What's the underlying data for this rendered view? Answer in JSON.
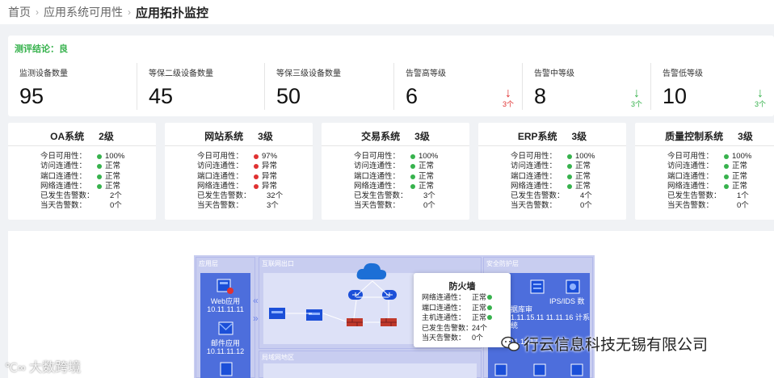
{
  "breadcrumb": {
    "items": [
      "首页",
      "应用系统可用性"
    ],
    "current": "应用拓扑监控"
  },
  "verdict": "测评结论：良",
  "stats": [
    {
      "label": "监测设备数量",
      "value": "95"
    },
    {
      "label": "等保二级设备数量",
      "value": "45"
    },
    {
      "label": "等保三级设备数量",
      "value": "50"
    },
    {
      "label": "告警高等级",
      "value": "6",
      "trend": "3个",
      "direction": "up"
    },
    {
      "label": "告警中等级",
      "value": "8",
      "trend": "3个",
      "direction": "down"
    },
    {
      "label": "告警低等级",
      "value": "10",
      "trend": "3个",
      "direction": "down"
    }
  ],
  "row_labels": {
    "availability": "今日可用性：",
    "access": "访问连通性：",
    "port": "端口连通性：",
    "network": "网络连通性：",
    "alarms_total": "已发生告警数：",
    "alarms_today": "当天告警数："
  },
  "systems": [
    {
      "name": "OA系统",
      "level": "2级",
      "availability": "100%",
      "access": "正常",
      "port": "正常",
      "network": "正常",
      "alarms_total": "2个",
      "alarms_today": "0个"
    },
    {
      "name": "网站系统",
      "level": "3级",
      "availability": "97%",
      "access": "异常",
      "port": "异常",
      "network": "异常",
      "alarms_total": "32个",
      "alarms_today": "3个"
    },
    {
      "name": "交易系统",
      "level": "3级",
      "availability": "100%",
      "access": "正常",
      "port": "正常",
      "network": "正常",
      "alarms_total": "3个",
      "alarms_today": "0个"
    },
    {
      "name": "ERP系统",
      "level": "3级",
      "availability": "100%",
      "access": "正常",
      "port": "正常",
      "network": "正常",
      "alarms_total": "4个",
      "alarms_today": "0个"
    },
    {
      "name": "质量控制系统",
      "level": "3级",
      "availability": "100%",
      "access": "正常",
      "port": "正常",
      "network": "正常",
      "alarms_total": "1个",
      "alarms_today": "0个"
    }
  ],
  "colors": {
    "ok": "#37b24d",
    "bad": "#e03131",
    "accent": "#37b24d"
  },
  "topology": {
    "zone_app": "应用层",
    "zone_internet": "互联网出口",
    "zone_security": "安全防护层",
    "zone_local": "局域网地区",
    "web_app": "Web应用",
    "web_ip": "10.11.11.11",
    "mail_app": "邮件应用",
    "mail_ip": "10.11.11.12",
    "ids_label": "IPS/IDS",
    "audit_label": "数据库审",
    "sec_ip1": "1.11.15.11",
    "sec_ip2": "11.11.16",
    "sec_tail": "计系统",
    "sec_ip3": "11.11.17"
  },
  "popup": {
    "title": "防火墙",
    "rows": [
      {
        "k": "网络连通性：",
        "v": "正常",
        "dot": true
      },
      {
        "k": "端口连通性：",
        "v": "正常",
        "dot": true
      },
      {
        "k": "主机连通性：",
        "v": "正常",
        "dot": true
      },
      {
        "k": "已发生告警数：",
        "v": "24个",
        "dot": false
      },
      {
        "k": "当天告警数：",
        "v": "0个",
        "dot": false
      }
    ]
  },
  "watermark_left": "大数跨境",
  "watermark_right": "行云信息科技无锡有限公司"
}
